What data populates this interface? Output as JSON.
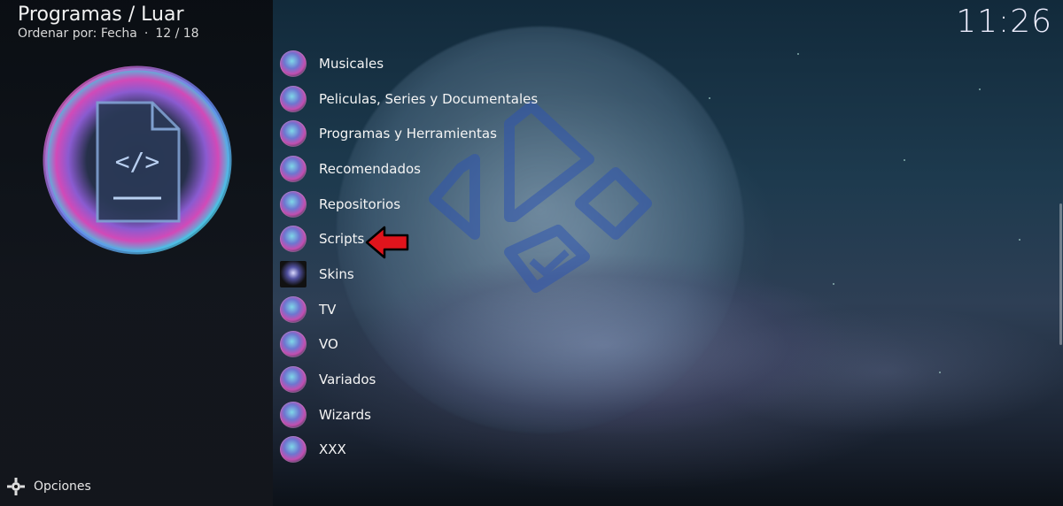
{
  "breadcrumb": {
    "title": "Programas / Luar",
    "sort_label": "Ordenar por: Fecha",
    "separator": "·",
    "position": "12 / 18"
  },
  "clock": "11:26",
  "footer": {
    "options_label": "Opciones",
    "options_icon": "gear-icon"
  },
  "list": {
    "items": [
      {
        "label": "Musicales",
        "icon": "addon-round-icon"
      },
      {
        "label": "Peliculas, Series y Documentales",
        "icon": "addon-round-icon"
      },
      {
        "label": "Programas y Herramientas",
        "icon": "addon-round-icon"
      },
      {
        "label": "Recomendados",
        "icon": "addon-round-icon"
      },
      {
        "label": "Repositorios",
        "icon": "addon-round-icon"
      },
      {
        "label": "Scripts",
        "icon": "addon-round-icon"
      },
      {
        "label": "Skins",
        "icon": "skin-thumbnail-icon"
      },
      {
        "label": "TV",
        "icon": "addon-round-icon"
      },
      {
        "label": "VO",
        "icon": "addon-round-icon"
      },
      {
        "label": "Variados",
        "icon": "addon-round-icon"
      },
      {
        "label": "Wizards",
        "icon": "addon-round-icon"
      },
      {
        "label": "XXX",
        "icon": "addon-round-icon"
      }
    ]
  },
  "colors": {
    "annotation_arrow": "#e0141c",
    "kodi_logo": "#2a4ea3",
    "panel_bg": "#0c0e12"
  }
}
